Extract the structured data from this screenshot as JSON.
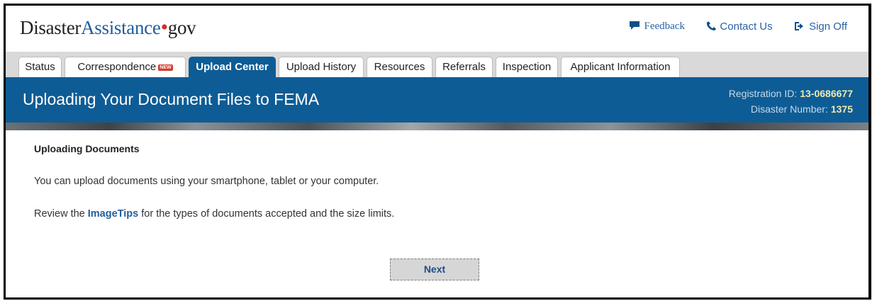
{
  "logo": {
    "part1": "Disaster",
    "part2": "Assistance",
    "dot": "•",
    "part3": "gov"
  },
  "top_links": {
    "feedback": "Feedback",
    "contact": "Contact Us",
    "signoff": "Sign Off"
  },
  "tabs": [
    {
      "label": "Status"
    },
    {
      "label": "Correspondence",
      "badge": "NEW"
    },
    {
      "label": "Upload Center"
    },
    {
      "label": "Upload History"
    },
    {
      "label": "Resources"
    },
    {
      "label": "Referrals"
    },
    {
      "label": "Inspection"
    },
    {
      "label": "Applicant Information"
    }
  ],
  "banner": {
    "title": "Uploading Your Document Files to FEMA",
    "registration_label": "Registration ID:",
    "registration_value": "13-0686677",
    "disaster_label": "Disaster Number:",
    "disaster_value": "1375"
  },
  "content": {
    "heading": "Uploading Documents",
    "para1": "You can upload documents using your smartphone, tablet or your computer.",
    "para2_before": "Review the ",
    "para2_link": "ImageTips",
    "para2_after": " for the types of documents accepted and the size limits."
  },
  "next_button": "Next",
  "colors": {
    "brand_blue": "#0e5c95",
    "link_blue": "#1f5e9a",
    "logo_dot_red": "#d92b2b",
    "highlight_yellow": "#f0e9a8"
  },
  "icons": {
    "feedback": "speech-bubble-icon",
    "contact": "phone-icon",
    "signoff": "sign-out-icon"
  }
}
